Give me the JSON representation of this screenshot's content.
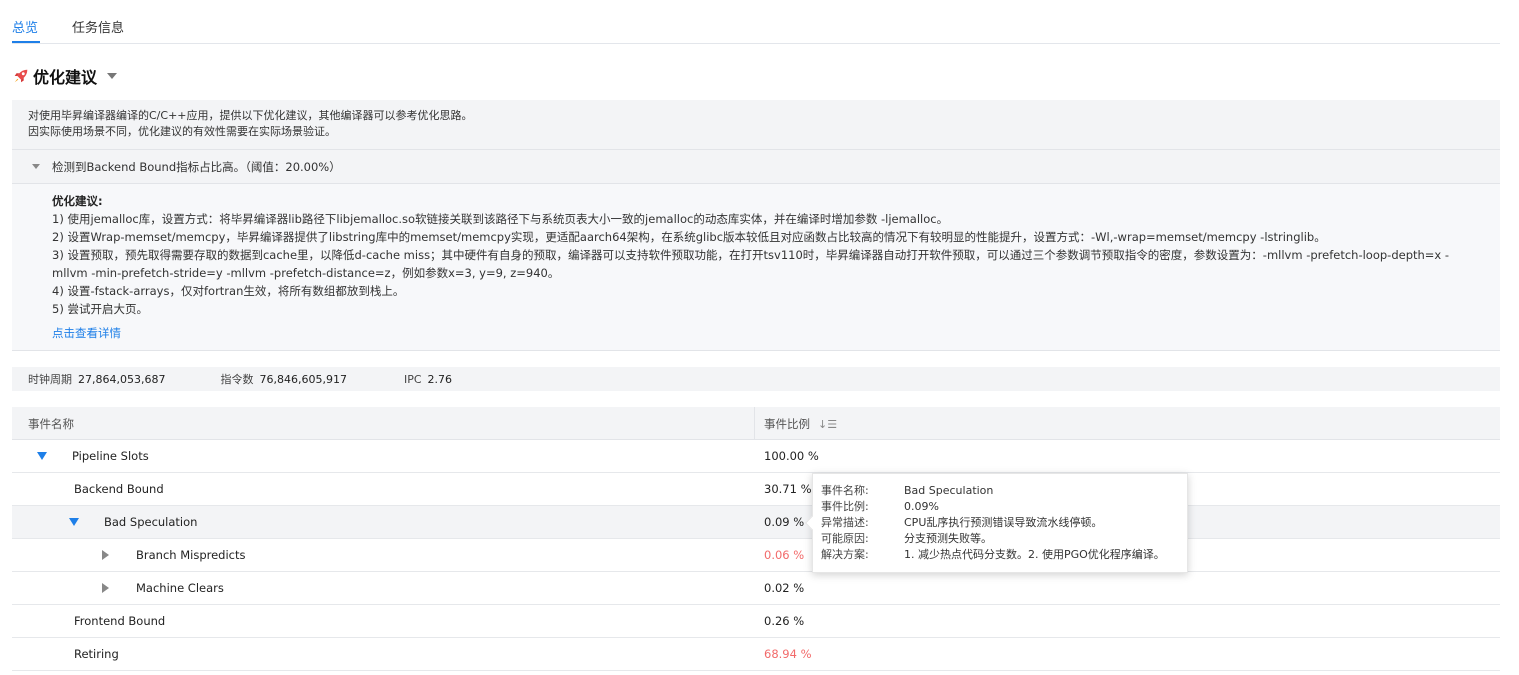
{
  "tabs": [
    {
      "label": "总览",
      "active": true
    },
    {
      "label": "任务信息",
      "active": false
    }
  ],
  "section": {
    "title": "优化建议",
    "icon": "rocket-icon"
  },
  "intro": {
    "line1": "对使用毕昇编译器编译的C/C++应用，提供以下优化建议，其他编译器可以参考优化思路。",
    "line2": "因实际使用场景不同，优化建议的有效性需要在实际场景验证。"
  },
  "collapse": {
    "label": "检测到Backend Bound指标占比高。（阈值：20.00%）"
  },
  "suggestions": {
    "title": "优化建议:",
    "items": [
      "1) 使用jemalloc库，设置方式：将毕昇编译器lib路径下libjemalloc.so软链接关联到该路径下与系统页表大小一致的jemalloc的动态库实体，并在编译时增加参数 -ljemalloc。",
      "2) 设置Wrap-memset/memcpy，毕昇编译器提供了libstring库中的memset/memcpy实现，更适配aarch64架构，在系统glibc版本较低且对应函数占比较高的情况下有较明显的性能提升，设置方式：-Wl,-wrap=memset/memcpy -lstringlib。",
      "3) 设置预取，预先取得需要存取的数据到cache里，以降低d-cache miss；其中硬件有自身的预取，编译器可以支持软件预取功能，在打开tsv110时，毕昇编译器自动打开软件预取，可以通过三个参数调节预取指令的密度，参数设置为：-mllvm -prefetch-loop-depth=x -mllvm -min-prefetch-stride=y -mllvm -prefetch-distance=z，例如参数x=3, y=9, z=940。",
      "4) 设置-fstack-arrays，仅对fortran生效，将所有数组都放到栈上。",
      "5) 尝试开启大页。"
    ],
    "link": "点击查看详情"
  },
  "metrics": {
    "cycles_label": "时钟周期",
    "cycles_value": "27,864,053,687",
    "instr_label": "指令数",
    "instr_value": "76,846,605,917",
    "ipc_label": "IPC",
    "ipc_value": "2.76"
  },
  "table": {
    "col_name": "事件名称",
    "col_ratio": "事件比例",
    "rows": [
      {
        "name": "Pipeline Slots",
        "value": "100.00 %",
        "level": 0,
        "toggle": "expanded"
      },
      {
        "name": "Backend Bound",
        "value": "30.71 %",
        "level": 1,
        "toggle": "none"
      },
      {
        "name": "Bad Speculation",
        "value": "0.09 %",
        "level": 1,
        "toggle": "expanded"
      },
      {
        "name": "Branch Mispredicts",
        "value": "0.06 %",
        "level": 2,
        "toggle": "collapsed",
        "alert": true
      },
      {
        "name": "Machine Clears",
        "value": "0.02 %",
        "level": 2,
        "toggle": "collapsed"
      },
      {
        "name": "Frontend Bound",
        "value": "0.26 %",
        "level": 1,
        "toggle": "none"
      },
      {
        "name": "Retiring",
        "value": "68.94 %",
        "level": 1,
        "toggle": "none",
        "alert": true
      }
    ]
  },
  "tooltip": {
    "name_label": "事件名称:",
    "name_value": "Bad Speculation",
    "ratio_label": "事件比例:",
    "ratio_value": "0.09%",
    "desc_label": "异常描述:",
    "desc_value": "CPU乱序执行预测错误导致流水线停顿。",
    "cause_label": "可能原因:",
    "cause_value": "分支预测失败等。",
    "fix_label": "解决方案:",
    "fix_value": "1. 减少热点代码分支数。2. 使用PGO优化程序编译。"
  },
  "colors": {
    "accent": "#1e7fe8",
    "alert": "#f26a6a"
  }
}
